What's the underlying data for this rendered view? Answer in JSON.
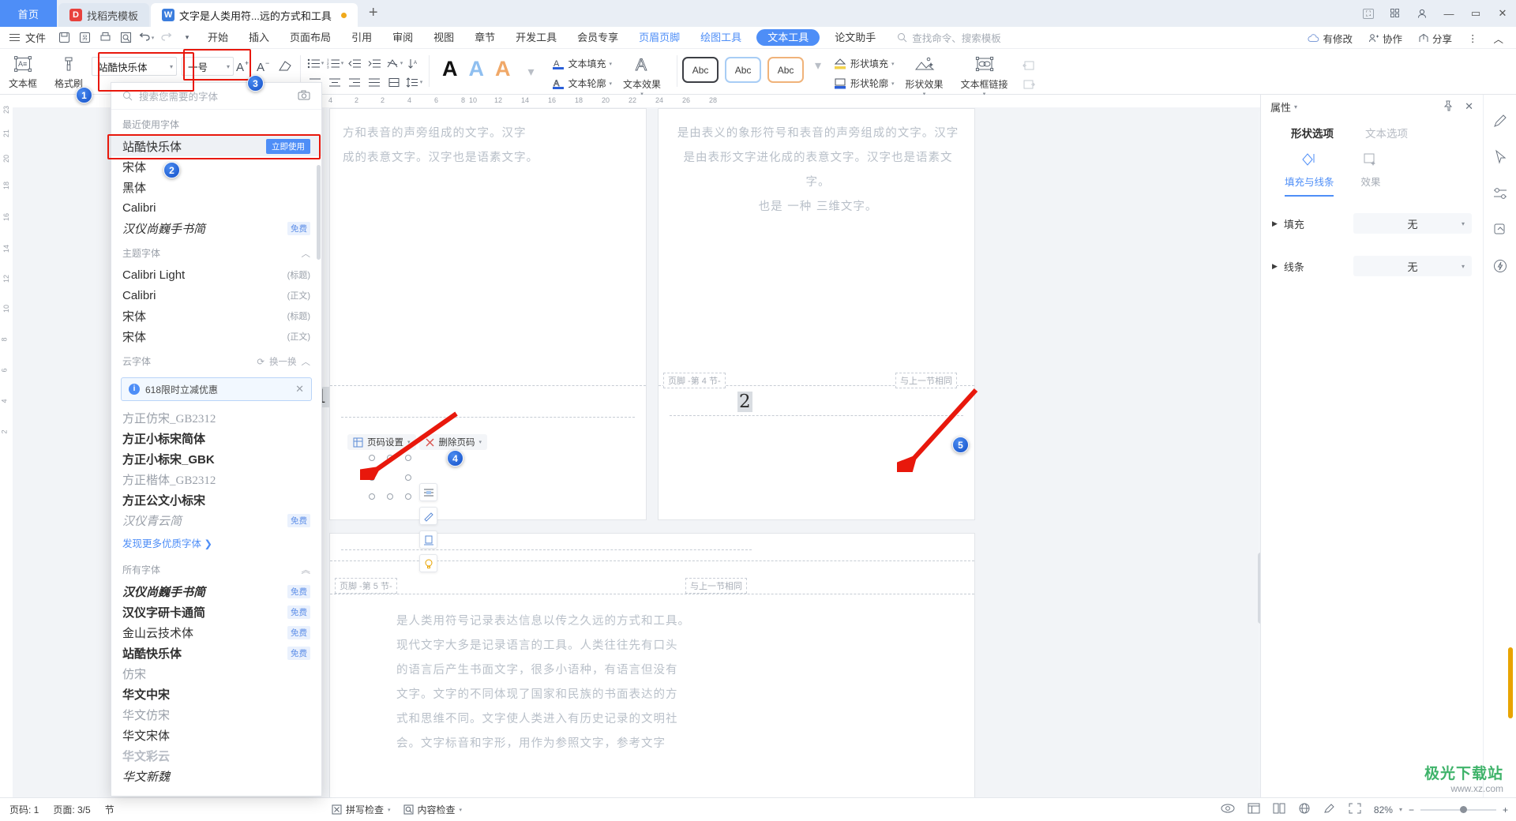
{
  "tabbar": {
    "home_label": "首页",
    "tabs": [
      {
        "label": "找稻壳模板",
        "icon": "docer-icon",
        "active": false
      },
      {
        "label": "文字是人类用符...远的方式和工具",
        "icon": "wps-writer-icon",
        "active": true
      }
    ],
    "new_tab_label": "+",
    "window_buttons": [
      "minimize",
      "maximize",
      "close"
    ]
  },
  "menubar": {
    "file_label": "文件",
    "quick_icons": [
      "save-icon",
      "save-as-icon",
      "print-icon",
      "print-preview-icon",
      "undo-icon",
      "redo-icon",
      "customize-icon"
    ],
    "items": [
      "开始",
      "插入",
      "页面布局",
      "引用",
      "审阅",
      "视图",
      "章节",
      "开发工具",
      "会员专享"
    ],
    "context_items": [
      "页眉页脚",
      "绘图工具"
    ],
    "active_context": "文本工具",
    "after_items": [
      "论文助手"
    ],
    "search_placeholder": "查找命令、搜索模板",
    "right_items": [
      "有修改",
      "协作",
      "分享"
    ],
    "right_overflow": "⋮",
    "right_collapse": "︿"
  },
  "ribbon": {
    "textbox_label": "文本框",
    "format_brush_label": "格式刷",
    "font_name": "站酷快乐体",
    "font_size": "一号",
    "grow_font": "A⁺",
    "shrink_font": "A⁻",
    "clear_format": "clear-format-icon",
    "text_fill_label": "文本填充",
    "text_outline_label": "文本轮廓",
    "text_effect_label": "文本效果",
    "shape_fill_label": "形状填充",
    "shape_outline_label": "形状轮廓",
    "shape_effect_label": "形状效果",
    "textbox_link_label": "文本框链接",
    "wordart_samples": [
      "A",
      "A",
      "A"
    ],
    "shapestyle_samples": [
      "Abc",
      "Abc",
      "Abc"
    ]
  },
  "font_panel": {
    "search_placeholder": "搜索您需要的字体",
    "sections": [
      {
        "title": "最近使用字体",
        "collapse": "",
        "items": [
          {
            "name": "站酷快乐体",
            "tag": "立即使用",
            "tag_kind": "use",
            "selected": true
          },
          {
            "name": "宋体",
            "tag": "",
            "tag_kind": ""
          },
          {
            "name": "黑体",
            "tag": "",
            "tag_kind": ""
          },
          {
            "name": "Calibri",
            "tag": "",
            "tag_kind": ""
          },
          {
            "name": "汉仪尚巍手书简",
            "tag": "免费",
            "tag_kind": "free"
          }
        ]
      },
      {
        "title": "主题字体",
        "collapse": "︿",
        "items": [
          {
            "name": "Calibri Light",
            "tag": "(标题)",
            "tag_kind": "theme"
          },
          {
            "name": "Calibri",
            "tag": "(正文)",
            "tag_kind": "theme"
          },
          {
            "name": "宋体",
            "tag": "(标题)",
            "tag_kind": "theme"
          },
          {
            "name": "宋体",
            "tag": "(正文)",
            "tag_kind": "theme"
          }
        ]
      },
      {
        "title": "云字体",
        "collapse": "︿",
        "refresh_label": "换一换",
        "promo": {
          "text": "618限时立减优惠",
          "close": "✕"
        },
        "items": [
          {
            "name": "方正仿宋_GB2312",
            "tag": "",
            "tag_kind": ""
          },
          {
            "name": "方正小标宋简体",
            "tag": "",
            "tag_kind": ""
          },
          {
            "name": "方正小标宋_GBK",
            "tag": "",
            "tag_kind": ""
          },
          {
            "name": "方正楷体_GB2312",
            "tag": "",
            "tag_kind": ""
          },
          {
            "name": "方正公文小标宋",
            "tag": "",
            "tag_kind": ""
          },
          {
            "name": "汉仪青云简",
            "tag": "免费",
            "tag_kind": "free"
          }
        ],
        "more_link": "发现更多优质字体 ❯"
      },
      {
        "title": "所有字体",
        "collapse": "︽",
        "items": [
          {
            "name": "汉仪尚巍手书简",
            "tag": "免费",
            "tag_kind": "free"
          },
          {
            "name": "汉仪字研卡通简",
            "tag": "免费",
            "tag_kind": "free"
          },
          {
            "name": "金山云技术体",
            "tag": "免费",
            "tag_kind": "free"
          },
          {
            "name": "站酷快乐体",
            "tag": "免费",
            "tag_kind": "free"
          },
          {
            "name": "仿宋",
            "tag": "",
            "tag_kind": ""
          },
          {
            "name": "华文中宋",
            "tag": "",
            "tag_kind": ""
          },
          {
            "name": "华文仿宋",
            "tag": "",
            "tag_kind": ""
          },
          {
            "name": "华文宋体",
            "tag": "",
            "tag_kind": ""
          },
          {
            "name": "华文彩云",
            "tag": "",
            "tag_kind": ""
          },
          {
            "name": "华文新魏",
            "tag": "",
            "tag_kind": ""
          }
        ]
      }
    ]
  },
  "document": {
    "ruler_ticks": [
      "4",
      "2",
      "2",
      "4",
      "6",
      "8",
      "10",
      "12",
      "14",
      "16",
      "18",
      "20",
      "22",
      "24",
      "26",
      "28"
    ],
    "page1_text": "方和表音的声旁组成的文字。汉字\n成的表意文字。汉字也是语素文字。",
    "page2_text": "是由表义的象形符号和表音的声旁组成的文字。汉字\n是由表形文字进化成的表意文字。汉字也是语素文字。\n也是 一种 三维文字。",
    "page3_text": "是人类用符号记录表达信息以传之久远的方式和工具。\n现代文字大多是记录语言的工具。人类往往先有口头\n的语言后产生书面文字，很多小语种，有语言但没有\n文字。文字的不同体现了国家和民族的书面表达的方\n式和思维不同。文字使人类进入有历史记录的文明社\n会。文字标音和字形，用作为参照文字，参考文字",
    "footer_toolbar": {
      "page_number_setup": "页码设置",
      "delete_page_number": "删除页码"
    },
    "section_tags": {
      "footer_sec4": "页脚 -第 4 节-",
      "footer_sec5": "页脚 -第 5 节-",
      "same_as_prev_a": "与上一节相同",
      "same_as_prev_b": "与上一节相同"
    },
    "page_numbers": [
      "1",
      "2"
    ]
  },
  "annotations": {
    "badges": [
      "1",
      "2",
      "3",
      "4",
      "5"
    ]
  },
  "properties": {
    "title": "属性",
    "pin_icon": "pin-icon",
    "close_icon": "close-icon",
    "tabs": [
      {
        "label": "形状选项",
        "active": true
      },
      {
        "label": "文本选项",
        "active": false
      }
    ],
    "subtabs": [
      {
        "label": "填充与线条",
        "active": true,
        "icon": "fill-line-icon"
      },
      {
        "label": "效果",
        "active": false,
        "icon": "effects-icon"
      }
    ],
    "rows": [
      {
        "label": "填充",
        "value": "无"
      },
      {
        "label": "线条",
        "value": "无"
      }
    ]
  },
  "rail": {
    "icons": [
      "pen-icon",
      "cursor-icon",
      "settings-sliders-icon",
      "layers-icon",
      "smart-icon"
    ]
  },
  "statusbar": {
    "page_label": "页码: 1",
    "pages_label": "页面: 3/5",
    "section_label": "节",
    "spellcheck": "拼写检查",
    "contentcheck": "内容检查",
    "right_icons": [
      "eye-icon",
      "read-layout-icon",
      "web-layout-icon",
      "print-layout-icon",
      "edit-icon",
      "fullscreen-icon"
    ],
    "zoom": "82%",
    "zoom_minus": "−",
    "zoom_plus": "+"
  },
  "watermark": {
    "line1": "极光下载站",
    "line2": "www.xz.com"
  },
  "colors": {
    "accent": "#4e8ef7",
    "tab_home_bg": "#4e8ef7",
    "annotation_red": "#e8180c",
    "badge_blue": "#1450c8",
    "free_tag": "#5e8fe8"
  }
}
